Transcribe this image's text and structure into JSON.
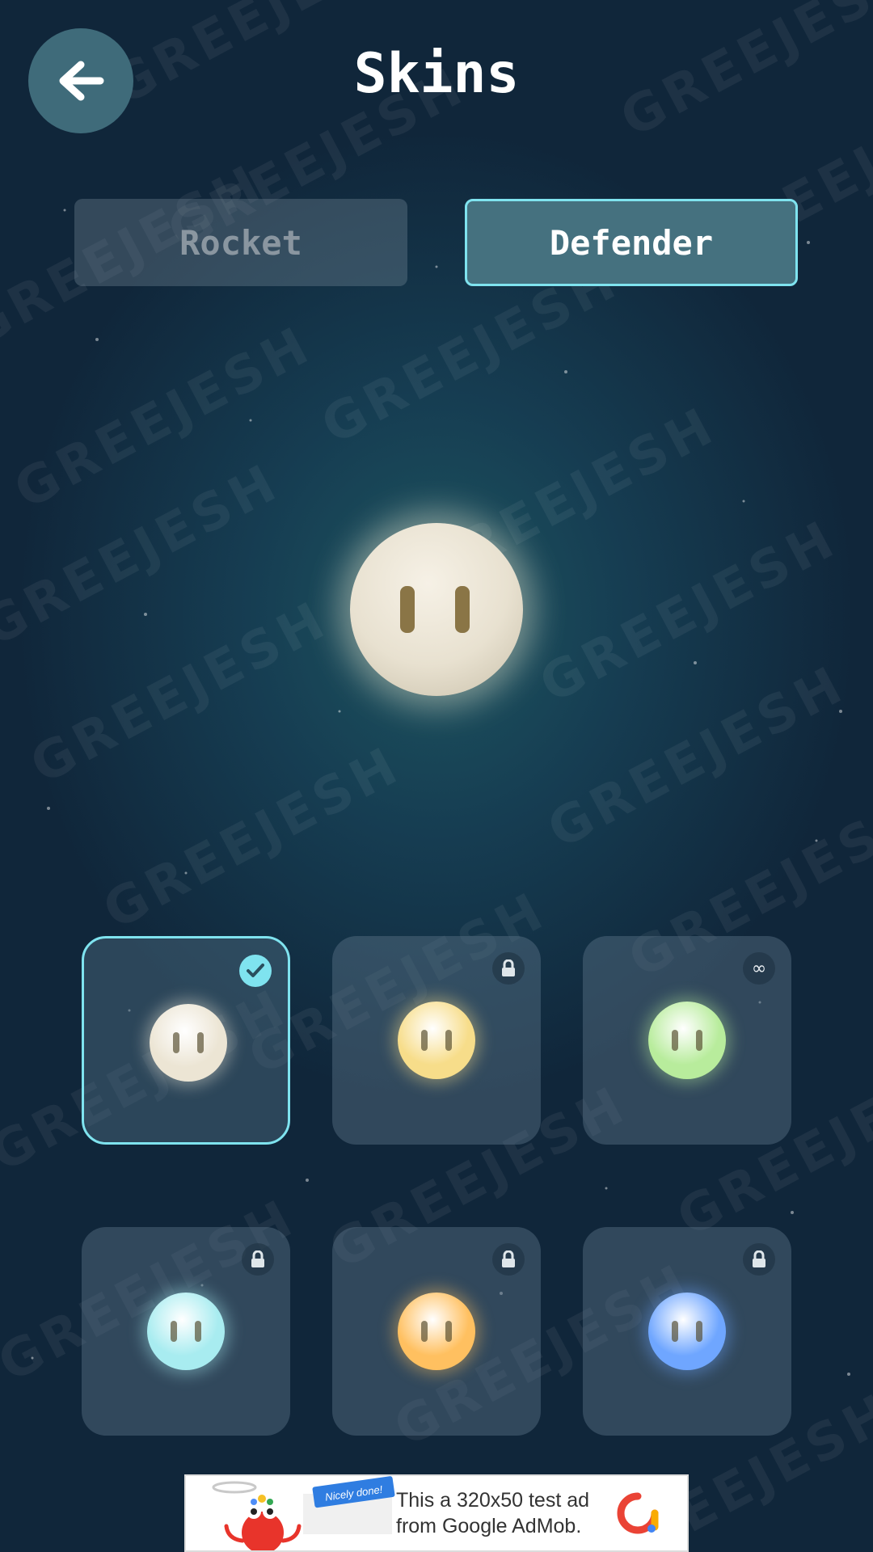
{
  "header": {
    "title": "Skins",
    "back_icon": "arrow-left-icon"
  },
  "tabs": [
    {
      "label": "Rocket",
      "active": false
    },
    {
      "label": "Defender",
      "active": true
    }
  ],
  "preview": {
    "skin_color": "#ece5d4"
  },
  "skins": [
    {
      "color": "#ece5d4",
      "status": "selected",
      "badge_icon": "check-icon"
    },
    {
      "color": "#f7dd8a",
      "status": "locked",
      "badge_icon": "lock-icon"
    },
    {
      "color": "#b8ec9c",
      "status": "unlimited",
      "badge_icon": "infinity-icon",
      "badge_text": "∞"
    },
    {
      "color": "#a8ecf0",
      "status": "locked",
      "badge_icon": "lock-icon"
    },
    {
      "color": "#ffc060",
      "status": "locked",
      "badge_icon": "lock-icon"
    },
    {
      "color": "#6fa6ff",
      "status": "locked",
      "badge_icon": "lock-icon"
    }
  ],
  "watermark": {
    "text": "GREEJESH"
  },
  "ad": {
    "line1": "This a 320x50 test ad",
    "line2": "from Google AdMob.",
    "sticker": "Nicely done!"
  },
  "colors": {
    "accent": "#7fe3ef",
    "tab_active_bg": "#45717f",
    "tab_inactive_text": "#8a96a0",
    "back_button_bg": "#3f6b7a"
  }
}
